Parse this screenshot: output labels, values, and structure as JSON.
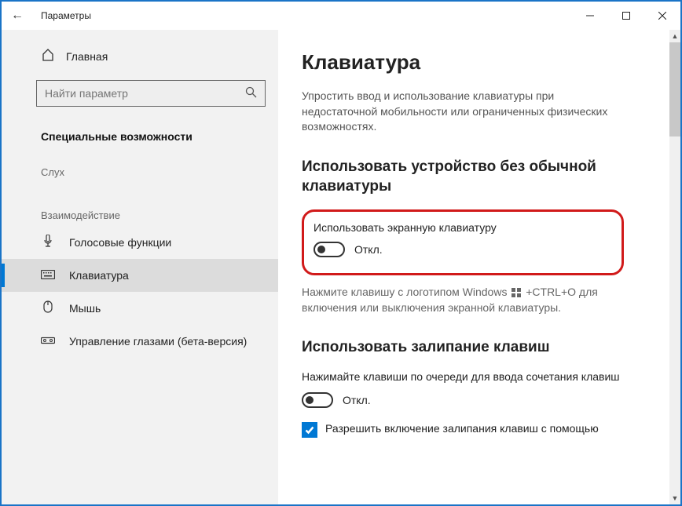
{
  "titlebar": {
    "title": "Параметры"
  },
  "sidebar": {
    "home": "Главная",
    "search_placeholder": "Найти параметр",
    "category": "Специальные возможности",
    "group1": "Слух",
    "group2": "Взаимодействие",
    "items": [
      {
        "label": "Голосовые функции"
      },
      {
        "label": "Клавиатура"
      },
      {
        "label": "Мышь"
      },
      {
        "label": "Управление глазами (бета-версия)"
      }
    ]
  },
  "content": {
    "title": "Клавиатура",
    "intro": "Упростить ввод и использование клавиатуры при недостаточной мобильности или ограниченных физических возможностях.",
    "section1_h": "Использовать устройство без обычной клавиатуры",
    "onscreen_label": "Использовать экранную клавиатуру",
    "toggle_off": "Откл.",
    "hint_pre": "Нажмите клавишу с логотипом Windows",
    "hint_post": "+CTRL+O для включения или выключения экранной клавиатуры.",
    "section2_h": "Использовать залипание клавиш",
    "sticky_desc": "Нажимайте клавиши по очереди для ввода сочетания клавиш",
    "sticky_allow": "Разрешить включение залипания клавиш с помощью"
  }
}
